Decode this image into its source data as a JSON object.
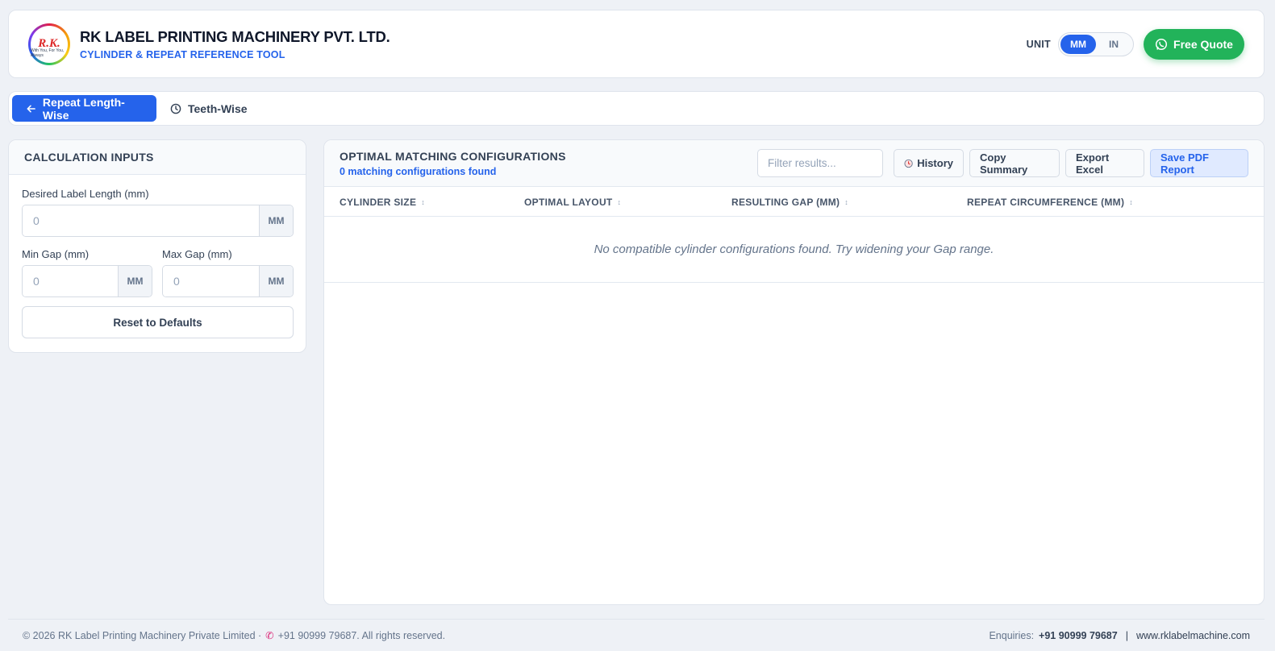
{
  "header": {
    "logo_text": "R.K.",
    "logo_tagline": "With You, For You, Always",
    "company_name": "RK LABEL PRINTING MACHINERY PVT. LTD.",
    "subtitle": "CYLINDER & REPEAT REFERENCE TOOL",
    "unit_label": "UNIT",
    "unit_options": [
      "MM",
      "IN"
    ],
    "unit_selected": "MM",
    "quote_label": "Free Quote"
  },
  "tabs": [
    {
      "label": "Repeat Length-Wise",
      "active": true,
      "icon": "arrow-left-icon"
    },
    {
      "label": "Teeth-Wise",
      "active": false,
      "icon": "clock-icon"
    }
  ],
  "inputs": {
    "title": "CALCULATION INPUTS",
    "label_length": {
      "label": "Desired Label Length (mm)",
      "placeholder": "0",
      "suffix": "MM"
    },
    "min_gap": {
      "label": "Min Gap (mm)",
      "placeholder": "0",
      "suffix": "MM"
    },
    "max_gap": {
      "label": "Max Gap (mm)",
      "placeholder": "0",
      "suffix": "MM"
    },
    "reset_label": "Reset to Defaults"
  },
  "results": {
    "title": "OPTIMAL MATCHING CONFIGURATIONS",
    "count_text": "0 matching configurations found",
    "filter_placeholder": "Filter results...",
    "history_label": "History",
    "copy_label": "Copy Summary",
    "export_label": "Export Excel",
    "pdf_label": "Save PDF Report",
    "columns": [
      "CYLINDER SIZE",
      "OPTIMAL LAYOUT",
      "RESULTING GAP (MM)",
      "REPEAT CIRCUMFERENCE (MM)"
    ],
    "sort_glyph": "↕",
    "empty_message": "No compatible cylinder configurations found. Try widening your Gap range."
  },
  "footer": {
    "copyright_prefix": "© 2026 RK Label Printing Machinery Private Limited ·",
    "copyright_phone": "+91 90999 79687. All rights reserved.",
    "enquiries_label": "Enquiries:",
    "enquiries_phone": "+91 90999 79687",
    "separator": "|",
    "website": "www.rklabelmachine.com"
  },
  "colors": {
    "accent": "#2563eb",
    "quote_green": "#22b35a",
    "background": "#eef1f6"
  }
}
